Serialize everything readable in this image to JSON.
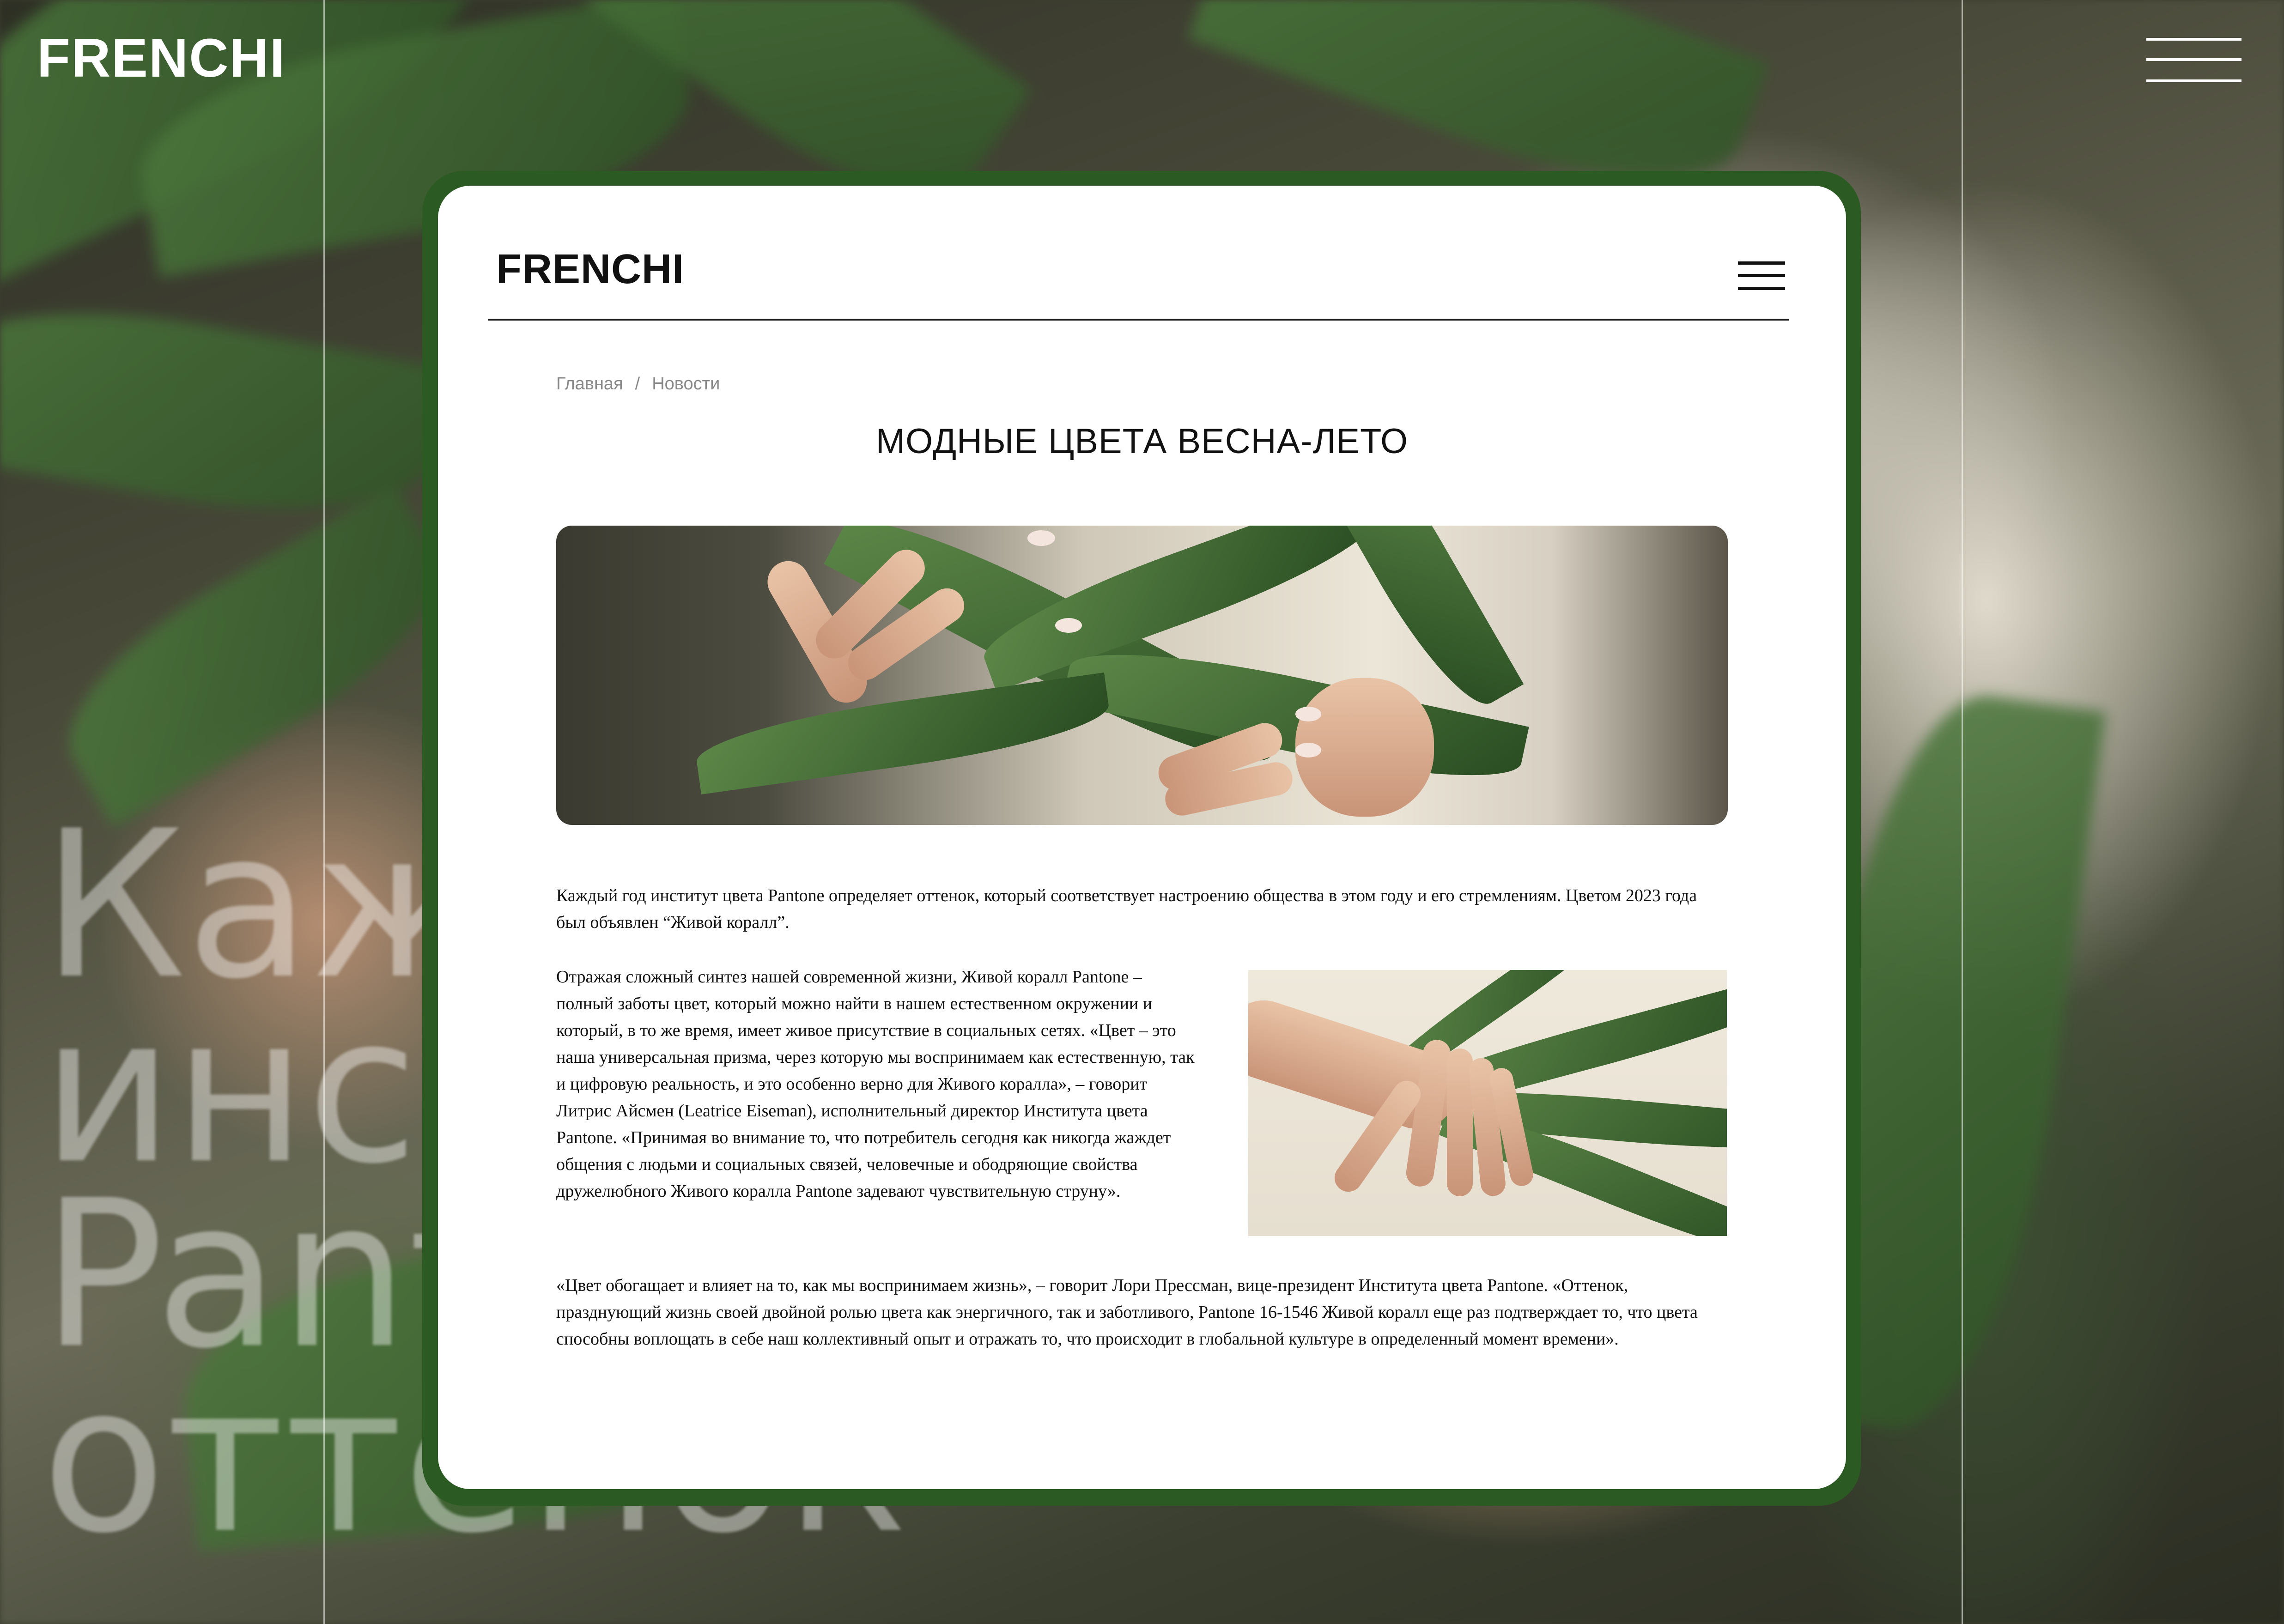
{
  "brand": {
    "outer_logo": "FRENCHI",
    "card_logo": "FRENCHI"
  },
  "background_text": "Кажд\nинст\nPant\nоттенок",
  "breadcrumb": {
    "home": "Главная",
    "separator": "/",
    "current": "Новости"
  },
  "article": {
    "title": "МОДНЫЕ ЦВЕТА ВЕСНА-ЛЕТО",
    "paragraph_1": "Каждый год институт цвета Pantone определяет оттенок, который соответствует настроению общества в этом году и его стремлениям. Цветом 2023 года был объявлен “Живой коралл”.",
    "paragraph_2": "Отражая сложный синтез нашей современной жизни, Живой коралл Pantone – полный заботы цвет, который можно найти в нашем естественном окружении и который, в то же время, имеет живое присутствие в социальных сетях. «Цвет – это наша универсальная призма, через которую мы воспринимаем как естественную, так и цифровую реальность, и это особенно верно для Живого коралла», – говорит Литрис Айсмен (Leatrice Eiseman), исполнительный директор Института цвета Pantone. «Принимая во внимание то, что потребитель сегодня как никогда жаждет общения с людьми и социальных связей, человечные и ободряющие свойства дружелюбного Живого коралла Pantone задевают чувствительную струну».",
    "paragraph_3": "«Цвет обогащает и влияет на то, как мы воспринимаем жизнь», – говорит Лори Прессман, вице-президент Института цвета Pantone. «Оттенок, празднующий жизнь своей двойной ролью цвета как энергичного, так и заботливого, Pantone 16-1546 Живой коралл еще раз подтверждает то, что цвета способны воплощать в себе наш коллективный опыт и отражать то, что происходит в глобальной культуре в определенный момент времени»."
  },
  "colors": {
    "card_frame": "#2b5a22",
    "card_bg": "#ffffff",
    "text": "#111111",
    "breadcrumb": "#888888"
  },
  "icons": {
    "outer_menu": "hamburger-icon",
    "card_menu": "hamburger-icon"
  }
}
